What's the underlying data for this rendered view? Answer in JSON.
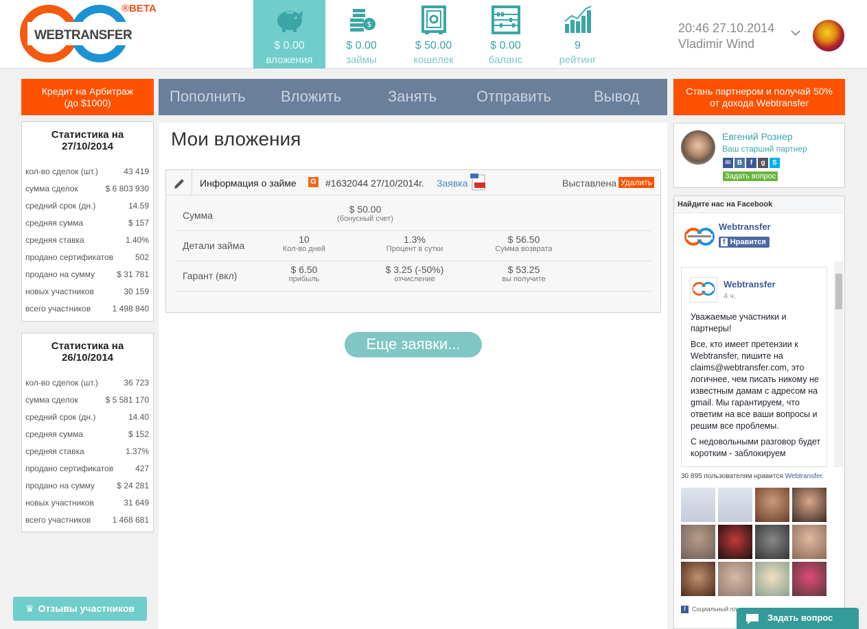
{
  "brand": {
    "name": "WEBTRANSFER",
    "badge": "®BETA"
  },
  "topnav": [
    {
      "value": "$ 0.00",
      "label": "вложения",
      "icon": "piggy-bank-icon",
      "active": true
    },
    {
      "value": "$ 0.00",
      "label": "займы",
      "icon": "coins-icon",
      "active": false
    },
    {
      "value": "$ 50.00",
      "label": "кошелек",
      "icon": "safe-icon",
      "active": false
    },
    {
      "value": "$ 0.00",
      "label": "баланс",
      "icon": "abacus-icon",
      "active": false
    },
    {
      "value": "9",
      "label": "рейтинг",
      "icon": "rating-chart-icon",
      "active": false
    }
  ],
  "user": {
    "datetime": "20:46 27.10.2014",
    "name": "Vladimir Wind"
  },
  "promo_left": "Кредит на Арбитраж\n(до $1000)",
  "promo_right": "Стань партнером и получай 50%\nот дохода Webtransfer",
  "menu": [
    "Пополнить",
    "Вложить",
    "Занять",
    "Отправить",
    "Вывод"
  ],
  "stats": [
    {
      "title": "Статистика на\n27/10/2014",
      "rows": [
        {
          "k": "кол-во сделок (шт.)",
          "v": "43 419"
        },
        {
          "k": "сумма сделок",
          "v": "$ 6 803 930"
        },
        {
          "k": "средний срок (дн.)",
          "v": "14.59"
        },
        {
          "k": "средняя сумма",
          "v": "$ 157"
        },
        {
          "k": "средняя ставка",
          "v": "1.40%"
        },
        {
          "k": "продано сертификатов",
          "v": "502"
        },
        {
          "k": "продано на сумму",
          "v": "$ 31 781"
        },
        {
          "k": "новых участников",
          "v": "30 159"
        },
        {
          "k": "всего участников",
          "v": "1 498 840"
        }
      ]
    },
    {
      "title": "Статистика на\n26/10/2014",
      "rows": [
        {
          "k": "кол-во сделок (шт.)",
          "v": "36 723"
        },
        {
          "k": "сумма сделок",
          "v": "$ 5 581 170"
        },
        {
          "k": "средний срок (дн.)",
          "v": "14.40"
        },
        {
          "k": "средняя сумма",
          "v": "$ 152"
        },
        {
          "k": "средняя ставка",
          "v": "1.37%"
        },
        {
          "k": "продано сертификатов",
          "v": "427"
        },
        {
          "k": "продано на сумму",
          "v": "$ 24 281"
        },
        {
          "k": "новых участников",
          "v": "31 649"
        },
        {
          "k": "всего участников",
          "v": "1 468 681"
        }
      ]
    }
  ],
  "main": {
    "title": "Мои вложения",
    "loan": {
      "header_title": "Информация о займе",
      "badge": "G",
      "number": "#1632044 27/10/2014г.",
      "link": "Заявка",
      "status": "Выставлена",
      "delete": "Удалить",
      "rows": [
        {
          "label": "Сумма",
          "cells": [
            {
              "big": "$ 50.00",
              "sm": "(бонусный счет)"
            }
          ]
        },
        {
          "label": "Детали займа",
          "cells": [
            {
              "big": "10",
              "sm": "Кол-во дней"
            },
            {
              "big": "1.3%",
              "sm": "Процент в сутки"
            },
            {
              "big": "$ 56.50",
              "sm": "Сумма возврата"
            }
          ]
        },
        {
          "label": "Гарант (вкл)",
          "cells": [
            {
              "big": "$ 6.50",
              "sm": "прибыль"
            },
            {
              "big": "$ 3.25 (-50%)",
              "sm": "отчисление"
            },
            {
              "big": "$ 53.25",
              "sm": "вы получите"
            }
          ]
        }
      ]
    },
    "more": "Еще заявки..."
  },
  "partner": {
    "name": "Евгений Рознер",
    "sub": "Ваш старший партнер",
    "ask": "Задать вопрос"
  },
  "facebook": {
    "header": "Найдите нас на Facebook",
    "page": "Webtransfer",
    "like": "Нравится",
    "post_author": "Webtransfer",
    "post_time": "4 ч.",
    "post_p1": "Уважаемые участники и партнеры!",
    "post_p2": "Все, кто имеет претензии к Webtransfer, пишите на claims@webtransfer.com, это логичнее, чем писать никому не известным дамам с адресом на gmail. Мы гарантируем, что ответим на все ваши вопросы и решим все проблемы.",
    "post_p3": "С недовольными разговор будет коротким - заблокируем",
    "count_prefix": "30 895 пользователям нравится ",
    "count_link": "Webtransfer.",
    "footer": "Социальный пл"
  },
  "reviews": "Отзывы участников",
  "ask_live": "Задать вопрос",
  "colors": {
    "accent": "#6fcdcb",
    "orange": "#fe5100",
    "menu": "#6a7f9a"
  }
}
